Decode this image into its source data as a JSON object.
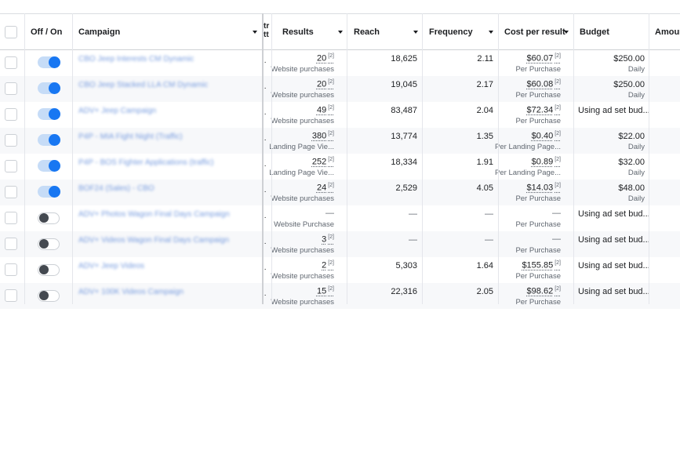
{
  "header": {
    "off_on": "Off / On",
    "campaign": "Campaign",
    "partial_col": "tr\ntt",
    "results": "Results",
    "reach": "Reach",
    "frequency": "Frequency",
    "cost_per_result": "Cost per result",
    "budget": "Budget",
    "amount": "Amoun"
  },
  "rows": [
    {
      "on": true,
      "campaign": "CBO Jeep Interests CM Dynamic",
      "results": "20",
      "results_label": "Website purchases",
      "reach": "18,625",
      "frequency": "2.11",
      "cost": "$60.07",
      "cost_label": "Per Purchase",
      "budget": "$250.00",
      "budget_label": "Daily"
    },
    {
      "on": true,
      "campaign": "CBO Jeep Stacked LLA CM Dynamic",
      "results": "20",
      "results_label": "Website purchases",
      "reach": "19,045",
      "frequency": "2.17",
      "cost": "$60.08",
      "cost_label": "Per Purchase",
      "budget": "$250.00",
      "budget_label": "Daily"
    },
    {
      "on": true,
      "campaign": "ADV+ Jeep Campaign",
      "results": "49",
      "results_label": "Website purchases",
      "reach": "83,487",
      "frequency": "2.04",
      "cost": "$72.34",
      "cost_label": "Per Purchase",
      "budget": "Using ad set bud...",
      "budget_label": ""
    },
    {
      "on": true,
      "campaign": "P4P - MIA Fight Night (Traffic)",
      "results": "380",
      "results_label": "Landing Page Vie...",
      "reach": "13,774",
      "frequency": "1.35",
      "cost": "$0.40",
      "cost_label": "Per Landing Page...",
      "budget": "$22.00",
      "budget_label": "Daily"
    },
    {
      "on": true,
      "campaign": "P4P - BOS Fighter Applications (traffic)",
      "results": "252",
      "results_label": "Landing Page Vie...",
      "reach": "18,334",
      "frequency": "1.91",
      "cost": "$0.89",
      "cost_label": "Per Landing Page...",
      "budget": "$32.00",
      "budget_label": "Daily"
    },
    {
      "on": true,
      "campaign": "BOF24 (Sales) - CBO",
      "results": "24",
      "results_label": "Website purchases",
      "reach": "2,529",
      "frequency": "4.05",
      "cost": "$14.03",
      "cost_label": "Per Purchase",
      "budget": "$48.00",
      "budget_label": "Daily"
    },
    {
      "on": false,
      "campaign": "ADV+ Photos Wagon Final Days Campaign",
      "results": "—",
      "results_label": "Website Purchase",
      "reach": "—",
      "frequency": "—",
      "cost": "—",
      "cost_label": "Per Purchase",
      "budget": "Using ad set bud...",
      "budget_label": ""
    },
    {
      "on": false,
      "campaign": "ADV+ Videos Wagon Final Days Campaign",
      "results": "3",
      "results_label": "Website purchases",
      "reach": "—",
      "frequency": "—",
      "cost": "—",
      "cost_label": "Per Purchase",
      "budget": "Using ad set bud...",
      "budget_label": ""
    },
    {
      "on": false,
      "campaign": "ADV+ Jeep Videos",
      "results": "2",
      "results_label": "Website purchases",
      "reach": "5,303",
      "frequency": "1.64",
      "cost": "$155.85",
      "cost_label": "Per Purchase",
      "budget": "Using ad set bud...",
      "budget_label": ""
    },
    {
      "on": false,
      "campaign": "ADV+ 100K Videos Campaign",
      "results": "15",
      "results_label": "Website purchases",
      "reach": "22,316",
      "frequency": "2.05",
      "cost": "$98.62",
      "cost_label": "Per Purchase",
      "budget": "Using ad set bud...",
      "budget_label": ""
    }
  ],
  "sup_mark": "[2]",
  "ellipsis_mark": "..",
  "icons": {
    "caret": "caret-down-icon",
    "toggle": "toggle-switch"
  },
  "colors": {
    "accent": "#1877f2",
    "toggle_track_on": "#c6dcf7",
    "link": "#4a7bd4"
  }
}
